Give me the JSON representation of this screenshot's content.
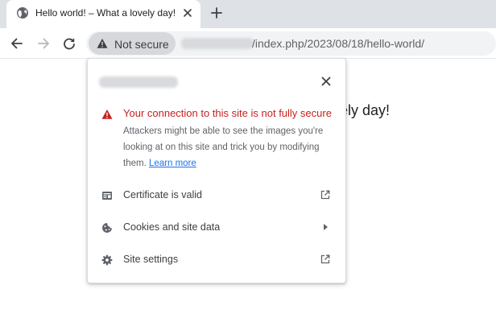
{
  "tab": {
    "title": "Hello world! – What a lovely day!",
    "favicon": "globe-icon",
    "close_icon": "close-icon",
    "new_tab_icon": "plus-icon"
  },
  "toolbar": {
    "back_icon": "arrow-left-icon",
    "forward_icon": "arrow-right-icon",
    "reload_icon": "reload-icon",
    "security_chip_label": "Not secure",
    "security_chip_icon": "warning-triangle-icon",
    "url_path": "/index.php/2023/08/18/hello-world/"
  },
  "page": {
    "heading_fragment": "vely day!"
  },
  "page_info": {
    "close_icon": "close-icon",
    "warning": {
      "title": "Your connection to this site is not fully secure",
      "body": "Attackers might be able to see the images you're looking at on this site and trick you by modifying them.",
      "link": "Learn more",
      "icon": "warning-triangle-icon"
    },
    "rows": [
      {
        "label": "Certificate is valid",
        "icon": "certificate-icon",
        "trailing": "external-link-icon"
      },
      {
        "label": "Cookies and site data",
        "icon": "cookie-icon",
        "trailing": "chevron-right-icon"
      },
      {
        "label": "Site settings",
        "icon": "gear-icon",
        "trailing": "external-link-icon"
      }
    ]
  },
  "colors": {
    "tabstrip": "#dee1e6",
    "omnibox": "#f1f3f4",
    "chip": "#d6d8db",
    "warning_red": "#c5221f",
    "link_blue": "#1a73e8",
    "text_gray": "#5f6368"
  }
}
